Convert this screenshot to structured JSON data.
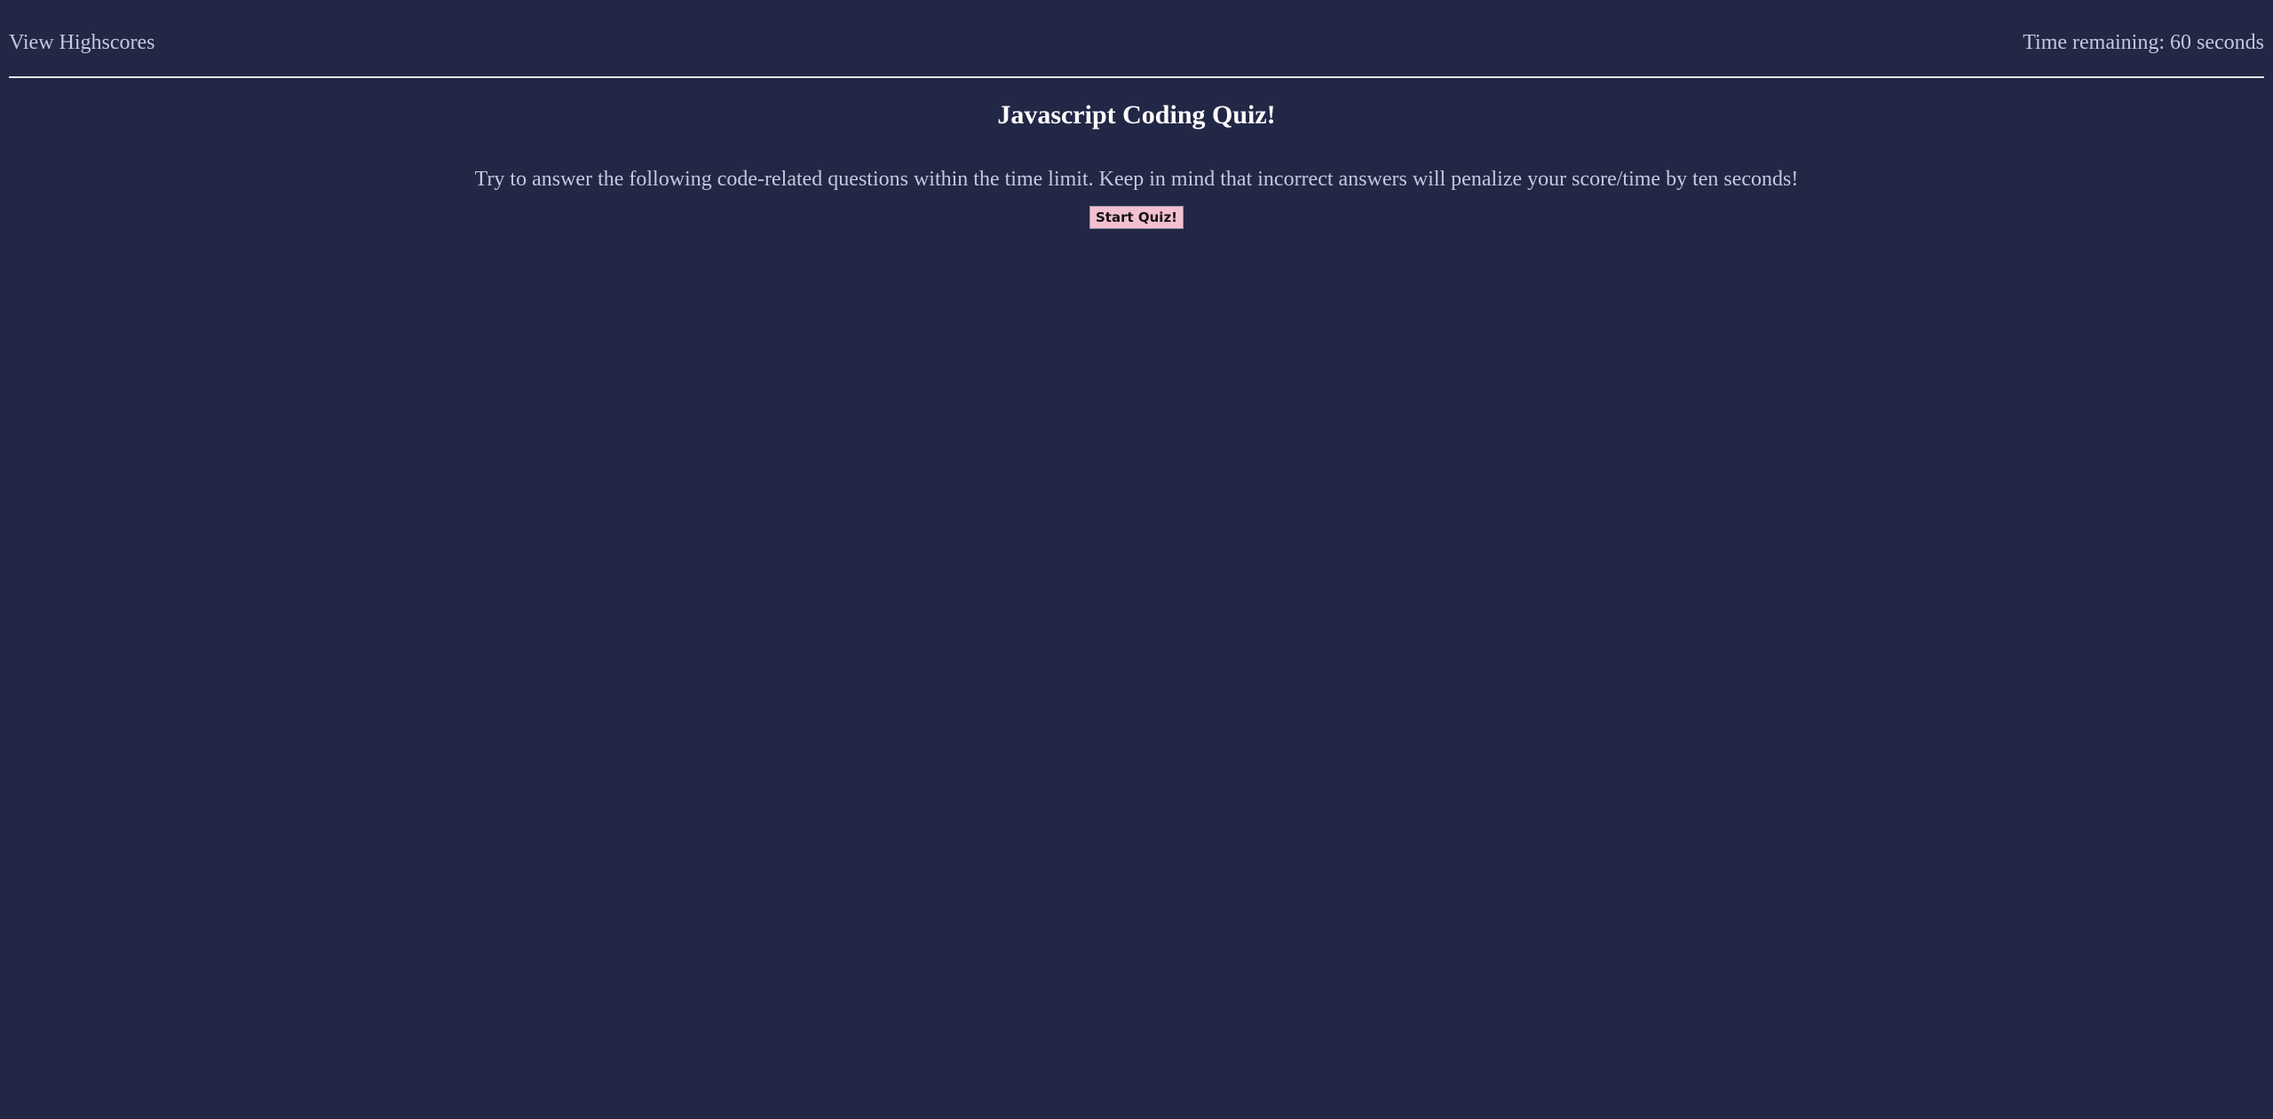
{
  "header": {
    "highscores_label": "View Highscores",
    "timer_text": "Time remaining: 60 seconds"
  },
  "main": {
    "title": "Javascript Coding Quiz!",
    "intro": "Try to answer the following code-related questions within the time limit. Keep in mind that incorrect answers will penalize your score/time by ten seconds!",
    "start_label": "Start Quiz!"
  },
  "colors": {
    "background": "#232746",
    "button": "#f3c0d2",
    "divider": "#e7e3ea",
    "text": "#c5c7dc",
    "title": "#ffffff"
  }
}
